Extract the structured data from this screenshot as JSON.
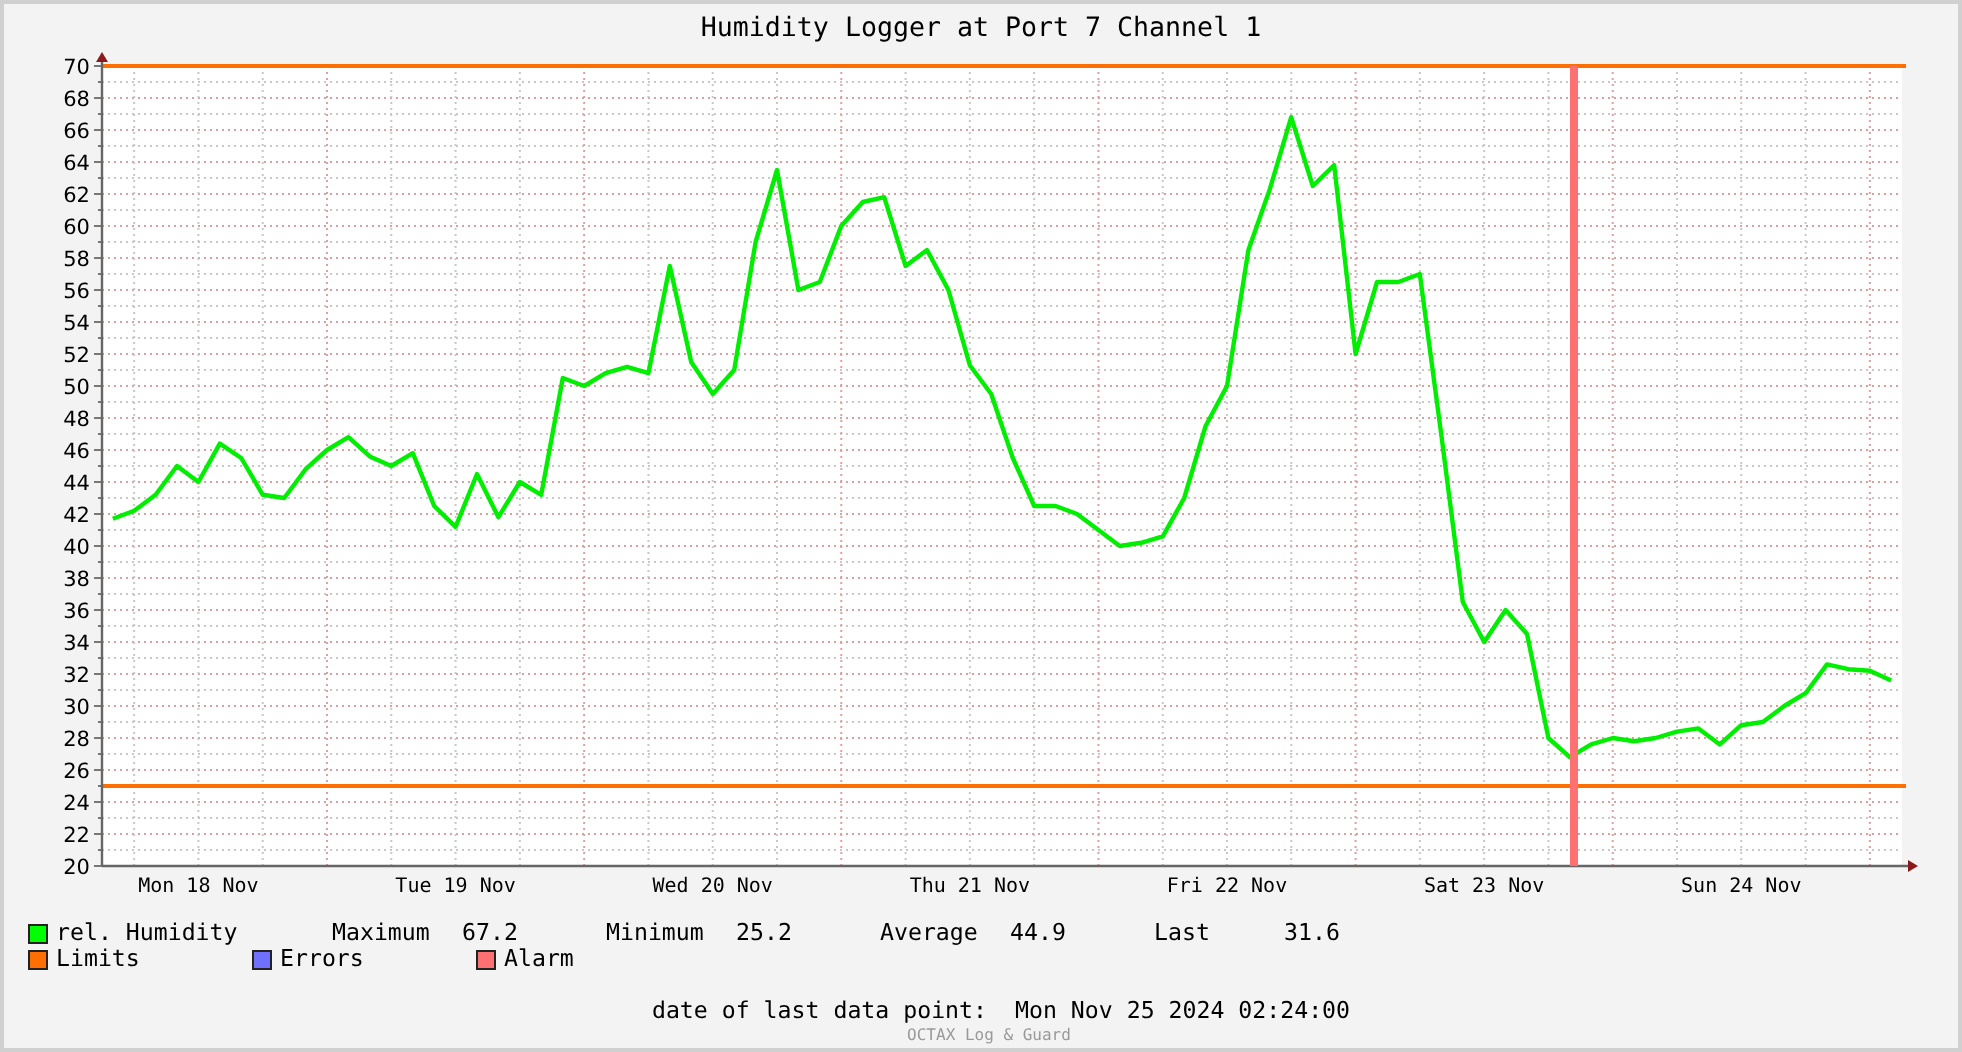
{
  "chart": {
    "chart_data": {
      "type": "line",
      "title": "Humidity Logger at Port 7 Channel 1",
      "categories": [
        null,
        null,
        null,
        null,
        "Mon 18 Nov",
        null,
        null,
        null,
        null,
        null,
        null,
        null,
        null,
        null,
        null,
        null,
        "Tue 19 Nov",
        null,
        null,
        null,
        null,
        null,
        null,
        null,
        null,
        null,
        null,
        null,
        "Wed 20 Nov",
        null,
        null,
        null,
        null,
        null,
        null,
        null,
        null,
        null,
        null,
        null,
        "Thu 21 Nov",
        null,
        null,
        null,
        null,
        null,
        null,
        null,
        null,
        null,
        null,
        null,
        "Fri 22 Nov",
        null,
        null,
        null,
        null,
        null,
        null,
        null,
        null,
        null,
        null,
        null,
        "Sat 23 Nov",
        null,
        null,
        null,
        null,
        null,
        null,
        null,
        null,
        null,
        null,
        null,
        "Sun 24 Nov",
        null,
        null,
        null,
        null,
        null,
        null,
        null
      ],
      "series": [
        {
          "name": "rel. Humidity",
          "color": "#00ee00",
          "values": [
            41.7,
            42.2,
            43.2,
            45,
            44,
            46.4,
            45.5,
            43.2,
            43,
            44.8,
            46,
            46.8,
            45.6,
            45,
            45.8,
            42.5,
            41.2,
            44.5,
            41.8,
            44,
            43.2,
            50.5,
            50,
            50.8,
            51.2,
            50.8,
            57.5,
            51.5,
            49.5,
            51,
            59,
            63.5,
            56,
            56.5,
            60,
            61.5,
            61.8,
            57.5,
            58.5,
            56,
            51.3,
            49.5,
            45.5,
            42.5,
            42.5,
            42,
            41,
            40,
            40.2,
            40.6,
            43,
            47.5,
            50,
            58.5,
            62.3,
            66.8,
            62.5,
            63.8,
            52,
            56.5,
            56.5,
            57,
            47,
            36.5,
            34,
            36,
            34.5,
            28,
            26.8,
            27.6,
            28,
            27.8,
            28,
            28.4,
            28.6,
            27.6,
            28.8,
            29,
            30,
            30.8,
            32.6,
            32.3,
            32.2,
            31.6
          ]
        }
      ],
      "ylim": [
        20,
        70
      ],
      "yticks": [
        20,
        22,
        24,
        26,
        28,
        30,
        32,
        34,
        36,
        38,
        40,
        42,
        44,
        46,
        48,
        50,
        52,
        54,
        56,
        58,
        60,
        62,
        64,
        66,
        68,
        70
      ],
      "grid": true,
      "ref_lines": [
        {
          "axis": "y",
          "value": 70
        },
        {
          "axis": "y",
          "value": 25
        }
      ]
    },
    "alarm_marker": {
      "level": 0.818
    }
  },
  "legend": [
    {
      "color": "#00ff00",
      "stats": [
        {
          "label": "Maximum",
          "value": "67.2"
        },
        {
          "label": "Minimum",
          "value": "25.2"
        },
        {
          "label": "Average",
          "value": "44.9"
        },
        {
          "label": "Last",
          "value": "31.6"
        }
      ]
    },
    {
      "label": "Limits",
      "color": "#ff6e00"
    },
    {
      "label": "Errors",
      "color": "#7070ff"
    },
    {
      "label": "Alarm",
      "color": "#ff7070"
    }
  ],
  "footer": {
    "label": "date of last data point:",
    "value": "Mon Nov 25 2024 02:24:00",
    "watermark": "OCTAX Log & Guard"
  }
}
